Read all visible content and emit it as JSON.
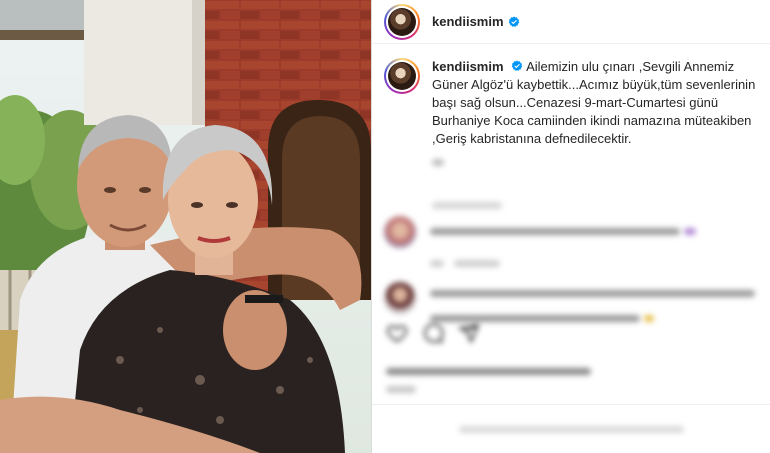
{
  "header": {
    "username": "kendiismim"
  },
  "caption": {
    "username": "kendiismim",
    "text": "Ailemizin ulu çınarı ,Sevgili Annemiz Güner Algöz'ü kaybettik...Acımız büyük,tüm sevenlerinin başı sağ olsun...Cenazesi 9-mart-Cumartesi günü Burhaniye Koca camiinden ikindi namazına müteakiben ,Geriş kabristanına defnedilecektir."
  },
  "colors": {
    "verified_blue": "#0095f6",
    "text_primary": "#262626",
    "text_secondary": "#8e8e8e",
    "divider": "#dbdbdb"
  },
  "icons": {
    "verified": "verified-badge-icon",
    "like": "heart-icon",
    "comment": "comment-icon",
    "share": "share-icon"
  }
}
